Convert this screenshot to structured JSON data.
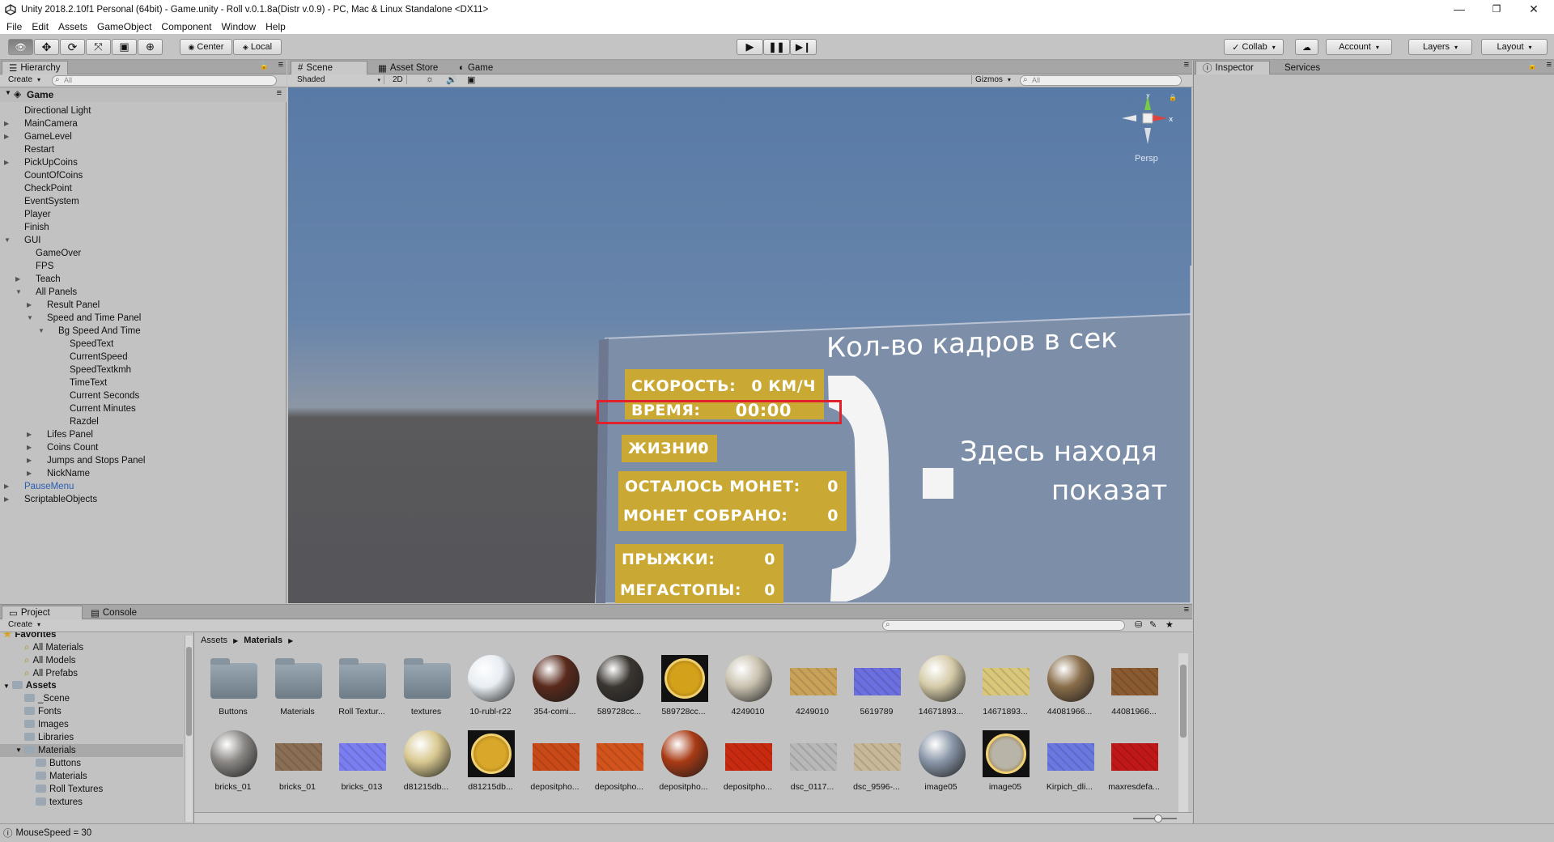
{
  "window": {
    "title": "Unity 2018.2.10f1 Personal (64bit) - Game.unity - Roll v.0.1.8a(Distr v.0.9) - PC, Mac & Linux Standalone <DX11>",
    "controls": {
      "minimize": "—",
      "maximize": "❐",
      "close": "✕"
    }
  },
  "menu": [
    "File",
    "Edit",
    "Assets",
    "GameObject",
    "Component",
    "Window",
    "Help"
  ],
  "toolbar": {
    "pivot": "Center",
    "space": "Local",
    "collab": "Collab",
    "account": "Account",
    "layers": "Layers",
    "layout": "Layout"
  },
  "hierarchy": {
    "tab": "Hierarchy",
    "create": "Create",
    "search_placeholder": "All",
    "scene_name": "Game",
    "items": [
      {
        "label": "Directional Light",
        "depth": 1,
        "arrow": ""
      },
      {
        "label": "MainCamera",
        "depth": 1,
        "arrow": "right"
      },
      {
        "label": "GameLevel",
        "depth": 1,
        "arrow": "right"
      },
      {
        "label": "Restart",
        "depth": 1,
        "arrow": ""
      },
      {
        "label": "PickUpCoins",
        "depth": 1,
        "arrow": "right"
      },
      {
        "label": "CountOfCoins",
        "depth": 1,
        "arrow": ""
      },
      {
        "label": "CheckPoint",
        "depth": 1,
        "arrow": ""
      },
      {
        "label": "EventSystem",
        "depth": 1,
        "arrow": ""
      },
      {
        "label": "Player",
        "depth": 1,
        "arrow": ""
      },
      {
        "label": "Finish",
        "depth": 1,
        "arrow": ""
      },
      {
        "label": "GUI",
        "depth": 1,
        "arrow": "down"
      },
      {
        "label": "GameOver",
        "depth": 2,
        "arrow": ""
      },
      {
        "label": "FPS",
        "depth": 2,
        "arrow": ""
      },
      {
        "label": "Teach",
        "depth": 2,
        "arrow": "right"
      },
      {
        "label": "All Panels",
        "depth": 2,
        "arrow": "down"
      },
      {
        "label": "Result Panel",
        "depth": 3,
        "arrow": "right"
      },
      {
        "label": "Speed and Time Panel",
        "depth": 3,
        "arrow": "down"
      },
      {
        "label": "Bg Speed And Time",
        "depth": 4,
        "arrow": "down"
      },
      {
        "label": "SpeedText",
        "depth": 5,
        "arrow": ""
      },
      {
        "label": "CurrentSpeed",
        "depth": 5,
        "arrow": ""
      },
      {
        "label": "SpeedTextkmh",
        "depth": 5,
        "arrow": ""
      },
      {
        "label": "TimeText",
        "depth": 5,
        "arrow": ""
      },
      {
        "label": "Current Seconds",
        "depth": 5,
        "arrow": ""
      },
      {
        "label": "Current Minutes",
        "depth": 5,
        "arrow": ""
      },
      {
        "label": "Razdel",
        "depth": 5,
        "arrow": ""
      },
      {
        "label": "Lifes Panel",
        "depth": 3,
        "arrow": "right"
      },
      {
        "label": "Coins Count",
        "depth": 3,
        "arrow": "right"
      },
      {
        "label": "Jumps and Stops Panel",
        "depth": 3,
        "arrow": "right"
      },
      {
        "label": "NickName",
        "depth": 3,
        "arrow": "right"
      },
      {
        "label": "PauseMenu",
        "depth": 1,
        "arrow": "right",
        "color": "#2a5db0"
      },
      {
        "label": "ScriptableObjects",
        "depth": 1,
        "arrow": "right"
      }
    ]
  },
  "scene_tabs": [
    "Scene",
    "Asset Store",
    "Game"
  ],
  "scene_bar": {
    "shading": "Shaded",
    "mode2d": "2D",
    "gizmos": "Gizmos",
    "search_placeholder": "All"
  },
  "gizmo": {
    "persp": "Persp"
  },
  "game_ui": {
    "fps_text": "Кол-во кадров в сек",
    "hint_line1": "Здесь находя",
    "hint_line2": "показат",
    "speed_label": "СКОРОСТЬ:",
    "speed_value": "0 КМ/Ч",
    "time_label": "ВРЕМЯ:",
    "time_value": "00:00",
    "lives_label": "ЖИЗНИ:",
    "lives_value": "0",
    "coins_left_label": "ОСТАЛОСЬ МОНЕТ:",
    "coins_left_value": "0",
    "coins_got_label": "МОНЕТ СОБРАНО:",
    "coins_got_value": "0",
    "jumps_label": "ПРЫЖКИ:",
    "jumps_value": "0",
    "stops_label": "МЕГАСТОПЫ:",
    "stops_value": "0",
    "highlight_color": "#e0202a",
    "panel_color": "#c9a934"
  },
  "inspector": {
    "tab": "Inspector",
    "services": "Services"
  },
  "project": {
    "tabs": [
      "Project",
      "Console"
    ],
    "create": "Create",
    "breadcrumb": [
      "Assets",
      "Materials"
    ],
    "favorites": {
      "title": "Favorites",
      "items": [
        "All Materials",
        "All Models",
        "All Prefabs"
      ]
    },
    "assets": {
      "title": "Assets",
      "items": [
        {
          "label": "_Scene",
          "depth": 1
        },
        {
          "label": "Fonts",
          "depth": 1
        },
        {
          "label": "Images",
          "depth": 1
        },
        {
          "label": "Libraries",
          "depth": 1
        },
        {
          "label": "Materials",
          "depth": 1,
          "selected": true
        },
        {
          "label": "Buttons",
          "depth": 2
        },
        {
          "label": "Materials",
          "depth": 2
        },
        {
          "label": "Roll Textures",
          "depth": 2
        },
        {
          "label": "textures",
          "depth": 2
        }
      ]
    },
    "grid": [
      {
        "label": "Buttons",
        "kind": "folder"
      },
      {
        "label": "Materials",
        "kind": "folder"
      },
      {
        "label": "Roll Textur...",
        "kind": "folder"
      },
      {
        "label": "textures",
        "kind": "folder"
      },
      {
        "label": "10-rubl-r22",
        "kind": "sphere",
        "color": "#e8eef3"
      },
      {
        "label": "354-comi...",
        "kind": "sphere",
        "color": "#5a2a1c"
      },
      {
        "label": "589728cc...",
        "kind": "sphere",
        "color": "#3a3530"
      },
      {
        "label": "589728cc...",
        "kind": "coin",
        "color": "#d4a21a"
      },
      {
        "label": "4249010",
        "kind": "sphere",
        "color": "#c9c2b0"
      },
      {
        "label": "4249010",
        "kind": "flat",
        "color": "#c9a25a"
      },
      {
        "label": "5619789",
        "kind": "flat",
        "color": "#6b6fe0"
      },
      {
        "label": "14671893...",
        "kind": "sphere",
        "color": "#d4cba8"
      },
      {
        "label": "14671893...",
        "kind": "flat",
        "color": "#d9c77a"
      },
      {
        "label": "44081966...",
        "kind": "sphere",
        "color": "#8a6e4a"
      },
      {
        "label": "44081966...",
        "kind": "flat",
        "color": "#8a5a30"
      },
      {
        "label": "bricks_01",
        "kind": "sphere",
        "color": "#8a8784"
      },
      {
        "label": "bricks_01",
        "kind": "flat",
        "color": "#8a6e55"
      },
      {
        "label": "bricks_013",
        "kind": "flat",
        "color": "#7a7ef0"
      },
      {
        "label": "d81215db...",
        "kind": "sphere",
        "color": "#d8c890"
      },
      {
        "label": "d81215db...",
        "kind": "coin",
        "color": "#d9a82a"
      },
      {
        "label": "depositpho...",
        "kind": "flat",
        "color": "#c94a18"
      },
      {
        "label": "depositpho...",
        "kind": "flat",
        "color": "#d2541c"
      },
      {
        "label": "depositpho...",
        "kind": "sphere",
        "color": "#a83a14"
      },
      {
        "label": "depositpho...",
        "kind": "flat",
        "color": "#c82a10"
      },
      {
        "label": "dsc_0117...",
        "kind": "flat",
        "color": "#b8b8b8"
      },
      {
        "label": "dsc_9596-...",
        "kind": "flat",
        "color": "#c8b898"
      },
      {
        "label": "image05",
        "kind": "sphere",
        "color": "#8a96a8"
      },
      {
        "label": "image05",
        "kind": "coin",
        "color": "#b8b4a8"
      },
      {
        "label": "Kirpich_dli...",
        "kind": "flat",
        "color": "#6a78e0"
      },
      {
        "label": "maxresdefa...",
        "kind": "flat",
        "color": "#c01818"
      }
    ]
  },
  "status": {
    "text": "MouseSpeed = 30"
  }
}
